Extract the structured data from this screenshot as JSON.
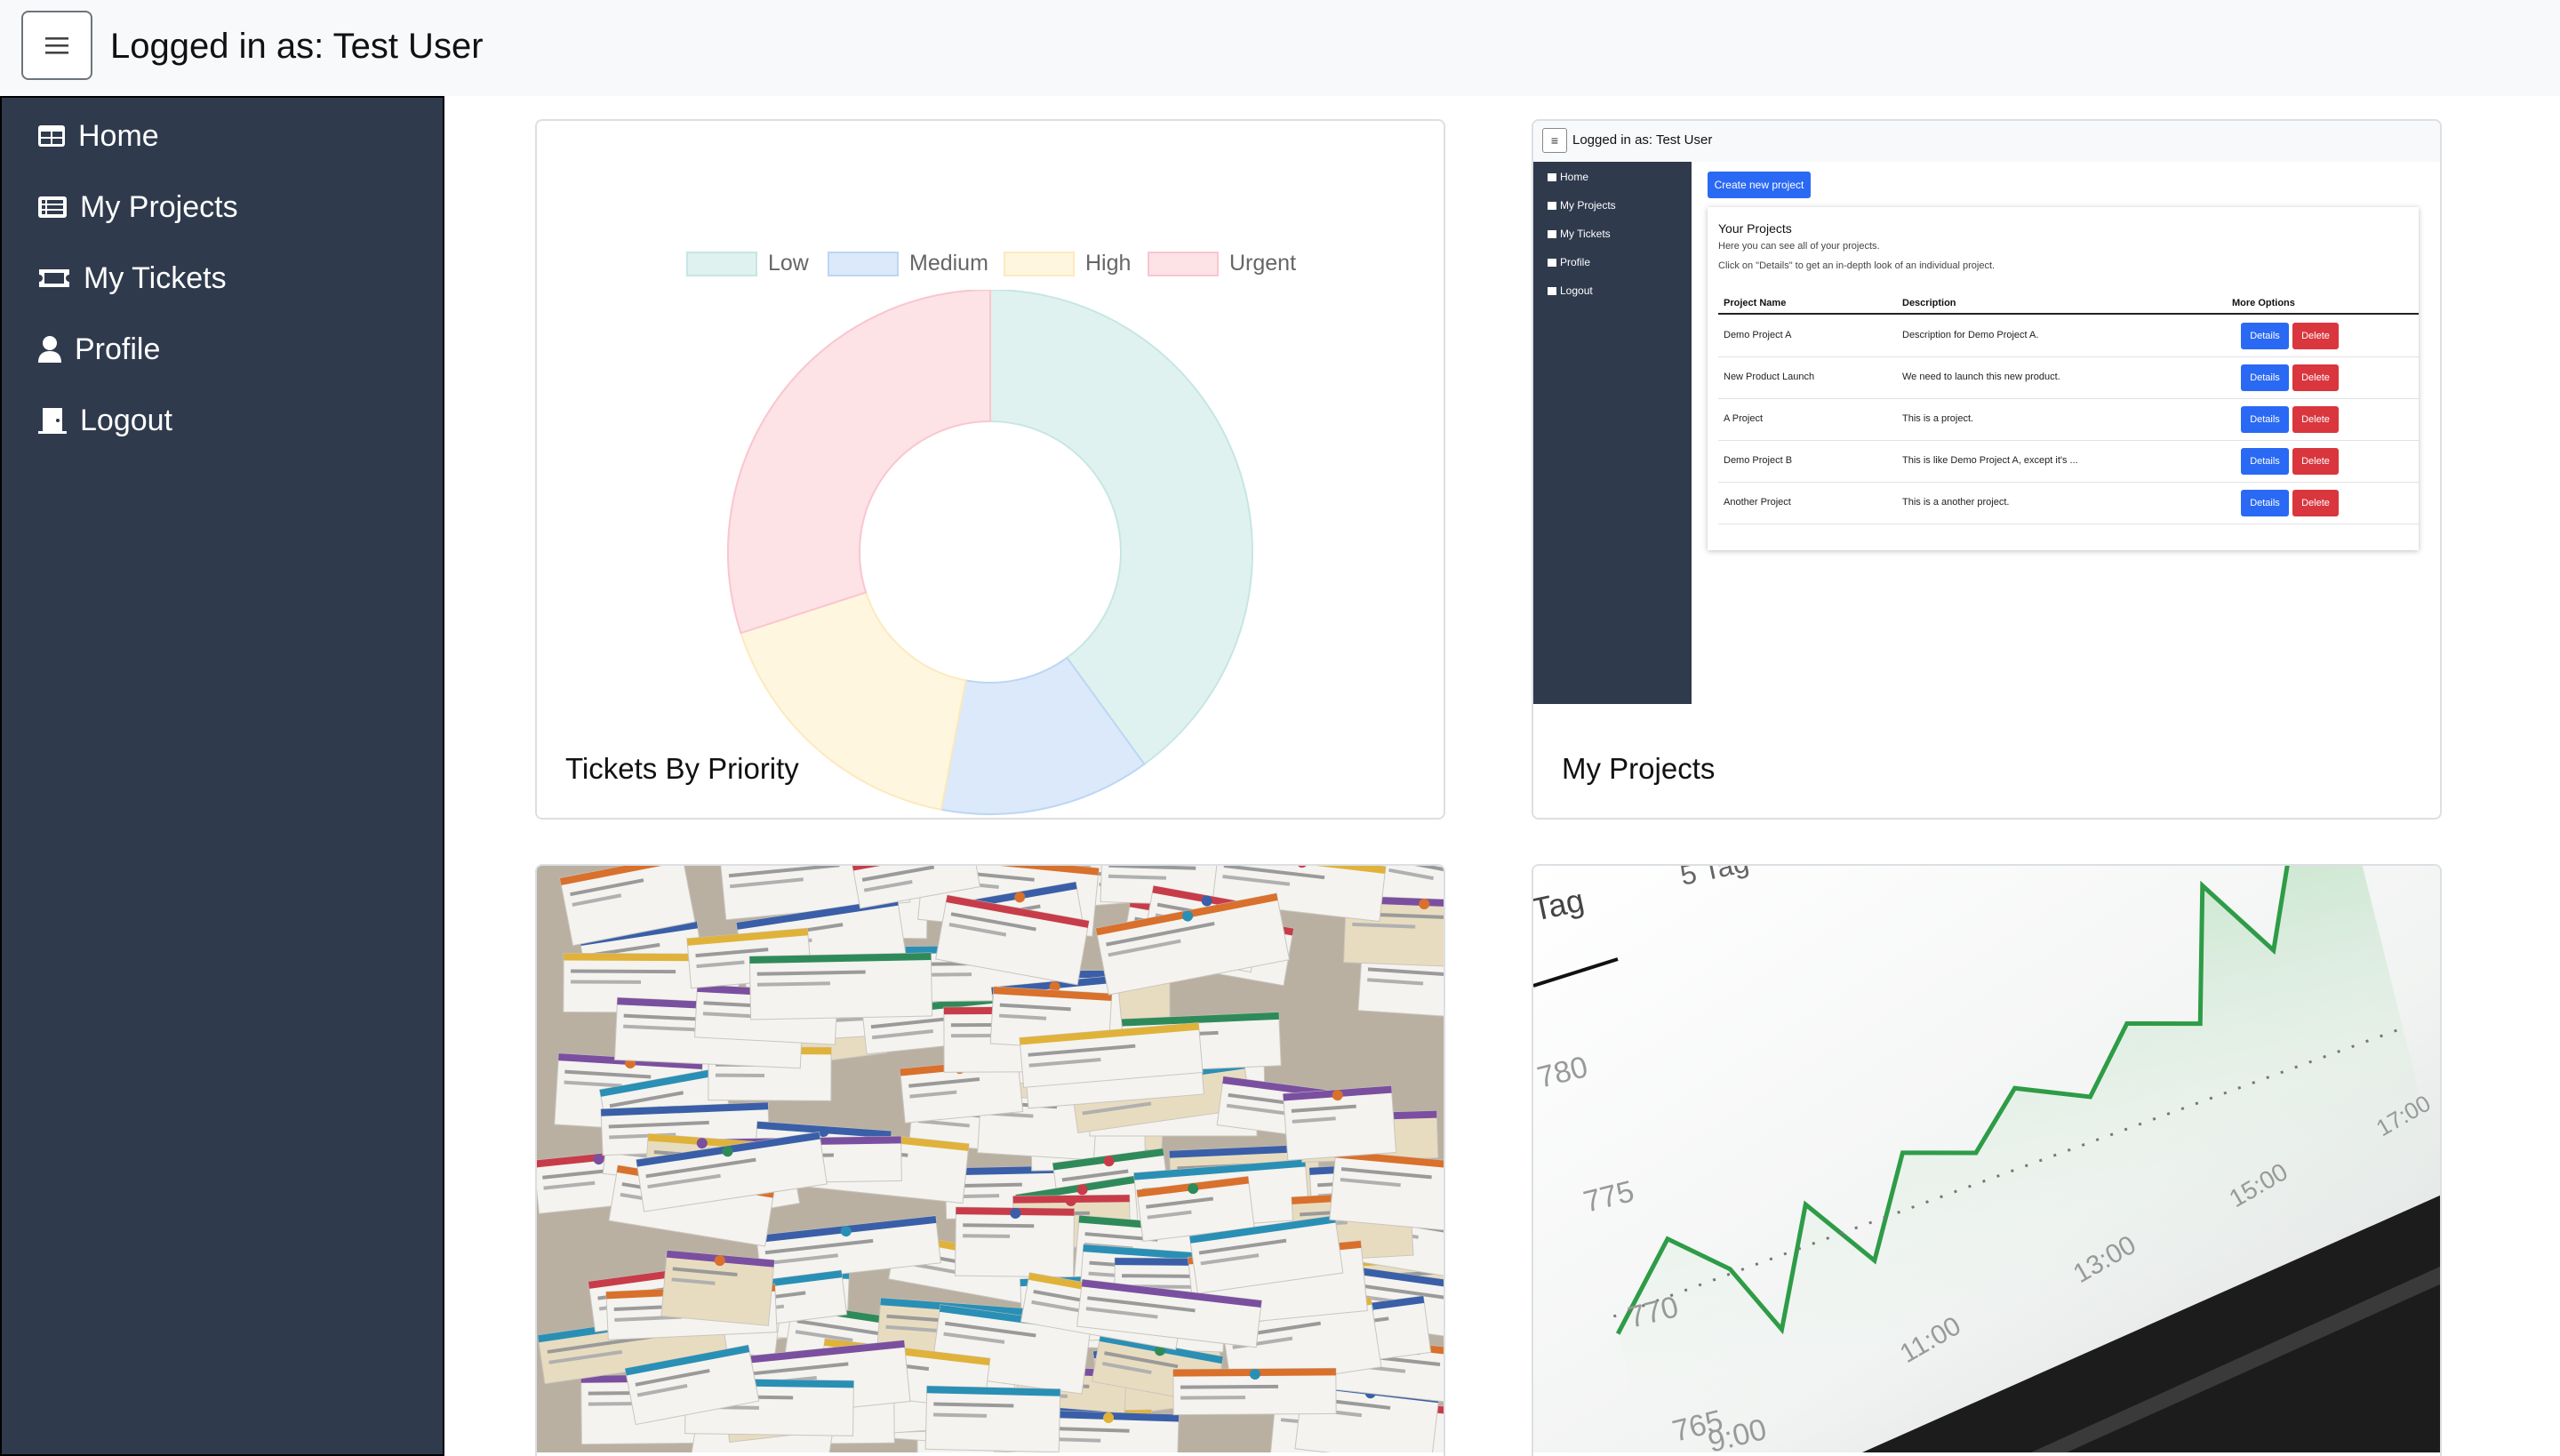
{
  "header": {
    "title": "Logged in as: Test User"
  },
  "sidebar": {
    "items": [
      {
        "label": "Home",
        "icon": "table-icon"
      },
      {
        "label": "My Projects",
        "icon": "list-icon"
      },
      {
        "label": "My Tickets",
        "icon": "ticket-icon"
      },
      {
        "label": "Profile",
        "icon": "user-icon"
      },
      {
        "label": "Logout",
        "icon": "door-icon"
      }
    ]
  },
  "cards": {
    "priority": {
      "title": "Tickets By Priority",
      "chart_data": {
        "type": "pie",
        "variant": "doughnut",
        "legend_position": "top",
        "categories": [
          "Low",
          "Medium",
          "High",
          "Urgent"
        ],
        "values": [
          40,
          13,
          17,
          30
        ],
        "colors": [
          "#e0f2f0",
          "#dce9fa",
          "#fff6e0",
          "#fde2e6"
        ],
        "border_colors": [
          "#c6e6e3",
          "#bcd6f4",
          "#fde9bd",
          "#f9c6cf"
        ]
      }
    },
    "projects": {
      "title": "My Projects",
      "preview": {
        "header_title": "Logged in as: Test User",
        "nav": [
          "Home",
          "My Projects",
          "My Tickets",
          "Profile",
          "Logout"
        ],
        "create_button": "Create new project",
        "panel_title": "Your Projects",
        "panel_subtitle": "Here you can see all of your projects.",
        "panel_hint": "Click on \"Details\" to get an in-depth look of an individual project.",
        "columns": [
          "Project Name",
          "Description",
          "More Options"
        ],
        "details_label": "Details",
        "delete_label": "Delete",
        "rows": [
          {
            "name": "Demo Project A",
            "description": "Description for Demo Project A."
          },
          {
            "name": "New Product Launch",
            "description": "We need to launch this new product."
          },
          {
            "name": "A Project",
            "description": "This is a project."
          },
          {
            "name": "Demo Project B",
            "description": "This is like Demo Project A, except it's ..."
          },
          {
            "name": "Another Project",
            "description": "This is a another project."
          }
        ]
      }
    },
    "tickets_photo": {
      "description_icon": "tickets-photo"
    },
    "stock_photo": {
      "visible_labels": {
        "y_ticks": [
          "780",
          "775",
          "770",
          "765"
        ],
        "x_ticks": [
          "11:00",
          "13:00",
          "15:00",
          "17:00",
          "9:00"
        ],
        "corner_text": "Tag",
        "top_text": "5 Tag"
      }
    }
  }
}
